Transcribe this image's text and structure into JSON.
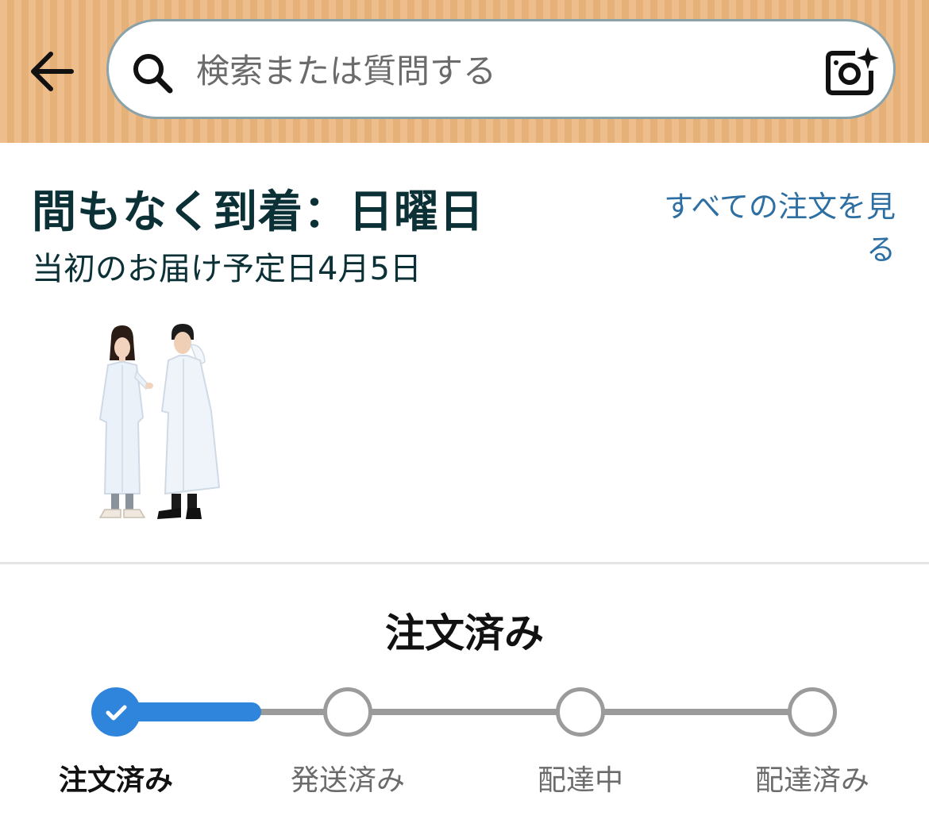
{
  "search": {
    "placeholder": "検索または質問する"
  },
  "icons": {
    "back": "arrow-left-icon",
    "search": "search-icon",
    "camera": "camera-sparkle-icon",
    "check": "check-icon"
  },
  "delivery": {
    "title": "間もなく到着：日曜日",
    "original_date": "当初のお届け予定日4月5日",
    "all_orders_link": "すべての注文を見る"
  },
  "status": {
    "heading": "注文済み",
    "progress_fraction": 0.21,
    "steps": [
      {
        "label": "注文済み",
        "state": "done"
      },
      {
        "label": "発送済み",
        "state": "pending"
      },
      {
        "label": "配達中",
        "state": "pending"
      },
      {
        "label": "配達済み",
        "state": "pending"
      }
    ]
  },
  "colors": {
    "header_bg": "#ebb77e",
    "title_text": "#0b3136",
    "link": "#2d6fa2",
    "progress_accent": "#2f85dc",
    "track": "#9b9b9b"
  }
}
